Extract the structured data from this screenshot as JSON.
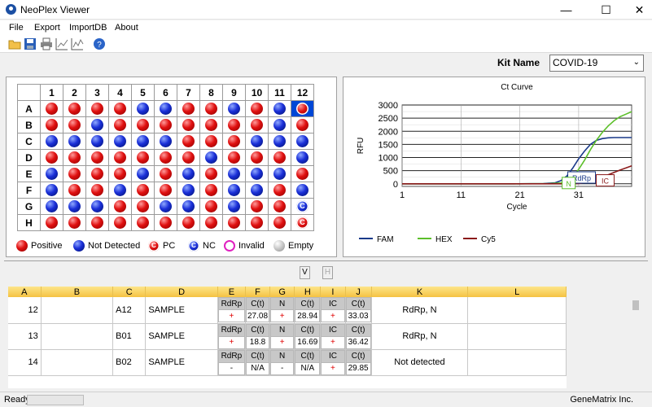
{
  "window": {
    "title": "NeoPlex Viewer",
    "minimize": "—",
    "maximize": "☐",
    "close": "✕"
  },
  "menu": {
    "file": "File",
    "export": "Export",
    "importdb": "ImportDB",
    "about": "About"
  },
  "kit": {
    "label": "Kit Name",
    "value": "COVID-19"
  },
  "plate": {
    "columns": [
      "1",
      "2",
      "3",
      "4",
      "5",
      "6",
      "7",
      "8",
      "9",
      "10",
      "11",
      "12"
    ],
    "rows": [
      {
        "label": "A",
        "wells": [
          "R",
          "R",
          "R",
          "R",
          "B",
          "B",
          "R",
          "R",
          "B",
          "R",
          "B",
          "PC-SEL"
        ]
      },
      {
        "label": "B",
        "wells": [
          "R",
          "R",
          "B",
          "R",
          "R",
          "R",
          "R",
          "R",
          "R",
          "R",
          "B",
          "R"
        ]
      },
      {
        "label": "C",
        "wells": [
          "B",
          "B",
          "B",
          "B",
          "B",
          "B",
          "R",
          "R",
          "R",
          "B",
          "B",
          "B"
        ]
      },
      {
        "label": "D",
        "wells": [
          "R",
          "R",
          "R",
          "R",
          "R",
          "R",
          "R",
          "B",
          "R",
          "R",
          "R",
          "B"
        ]
      },
      {
        "label": "E",
        "wells": [
          "B",
          "R",
          "R",
          "R",
          "B",
          "R",
          "B",
          "R",
          "B",
          "B",
          "B",
          "R"
        ]
      },
      {
        "label": "F",
        "wells": [
          "B",
          "R",
          "R",
          "B",
          "R",
          "R",
          "B",
          "R",
          "B",
          "B",
          "R",
          "B"
        ]
      },
      {
        "label": "G",
        "wells": [
          "B",
          "B",
          "B",
          "R",
          "R",
          "B",
          "B",
          "R",
          "B",
          "R",
          "R",
          "NC"
        ]
      },
      {
        "label": "H",
        "wells": [
          "R",
          "R",
          "R",
          "R",
          "R",
          "R",
          "R",
          "R",
          "R",
          "R",
          "R",
          "PC"
        ]
      }
    ],
    "pc_letter": "C",
    "nc_letter": "C"
  },
  "legend": {
    "positive": "Positive",
    "not_detected": "Not Detected",
    "pc": "PC",
    "nc": "NC",
    "invalid": "Invalid",
    "empty": "Empty"
  },
  "chart_data": {
    "type": "line",
    "title": "Ct Curve",
    "xlabel": "Cycle",
    "ylabel": "RFU",
    "xlim": [
      1,
      40
    ],
    "ylim": [
      -100,
      3000
    ],
    "xticks": [
      1,
      11,
      21,
      31
    ],
    "yticks": [
      0,
      250,
      500,
      750,
      1000,
      1250,
      1500,
      1750,
      2000,
      2250,
      2500,
      2750,
      3000
    ],
    "series": [
      {
        "name": "FAM",
        "color": "#1a3a8a",
        "x": [
          1,
          10,
          20,
          25,
          27,
          28,
          29,
          30,
          31,
          32,
          33,
          34,
          35,
          36,
          37,
          38,
          39,
          40
        ],
        "y": [
          0,
          0,
          0,
          10,
          40,
          120,
          300,
          600,
          950,
          1250,
          1500,
          1650,
          1720,
          1750,
          1760,
          1760,
          1760,
          1760
        ]
      },
      {
        "name": "HEX",
        "color": "#5cbf2a",
        "x": [
          1,
          10,
          20,
          26,
          28,
          29,
          30,
          31,
          32,
          33,
          34,
          35,
          36,
          37,
          38,
          39,
          40
        ],
        "y": [
          0,
          0,
          0,
          5,
          30,
          100,
          250,
          550,
          900,
          1300,
          1650,
          1950,
          2200,
          2400,
          2550,
          2650,
          2750
        ]
      },
      {
        "name": "Cy5",
        "color": "#8b1a1a",
        "x": [
          1,
          10,
          20,
          30,
          31,
          32,
          33,
          34,
          35,
          36,
          37,
          38,
          39,
          40
        ],
        "y": [
          0,
          0,
          0,
          0,
          10,
          40,
          90,
          160,
          250,
          340,
          430,
          520,
          600,
          680
        ]
      }
    ],
    "annotations": [
      {
        "text": "RdRp",
        "color": "#1a3a8a"
      },
      {
        "text": "N",
        "color": "#5cbf2a"
      },
      {
        "text": "IC",
        "color": "#8b1a1a"
      }
    ],
    "legend_position": "bottom-left"
  },
  "vh_buttons": {
    "v": "V",
    "h": "H"
  },
  "grid": {
    "columns": [
      "A",
      "B",
      "C",
      "D",
      "E",
      "F",
      "G",
      "H",
      "I",
      "J",
      "K",
      "L"
    ],
    "sub_headers": [
      "RdRp",
      "C(t)",
      "N",
      "C(t)",
      "IC",
      "C(t)"
    ],
    "rows": [
      {
        "num": "12",
        "well": "A12",
        "name": "SAMPLE",
        "vals": [
          "+",
          "27.08",
          "+",
          "28.94",
          "+",
          "33.03"
        ],
        "result": "RdRp, N"
      },
      {
        "num": "13",
        "well": "B01",
        "name": "SAMPLE",
        "vals": [
          "+",
          "18.8",
          "+",
          "16.69",
          "+",
          "36.42"
        ],
        "result": "RdRp, N"
      },
      {
        "num": "14",
        "well": "B02",
        "name": "SAMPLE",
        "vals": [
          "-",
          "N/A",
          "-",
          "N/A",
          "+",
          "29.85"
        ],
        "result": "Not detected"
      }
    ]
  },
  "status": {
    "ready": "Ready",
    "company": "GeneMatrix Inc."
  }
}
